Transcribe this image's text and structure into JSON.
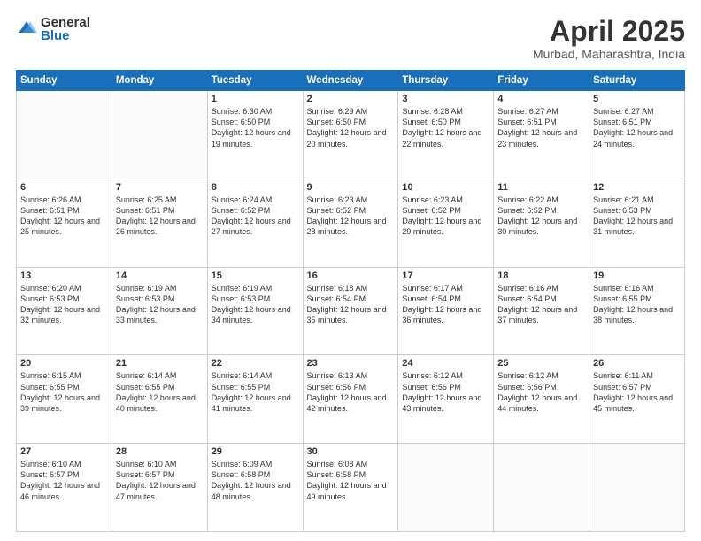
{
  "header": {
    "logo_general": "General",
    "logo_blue": "Blue",
    "title": "April 2025",
    "subtitle": "Murbad, Maharashtra, India"
  },
  "days_of_week": [
    "Sunday",
    "Monday",
    "Tuesday",
    "Wednesday",
    "Thursday",
    "Friday",
    "Saturday"
  ],
  "weeks": [
    [
      {
        "day": "",
        "info": ""
      },
      {
        "day": "",
        "info": ""
      },
      {
        "day": "1",
        "info": "Sunrise: 6:30 AM\nSunset: 6:50 PM\nDaylight: 12 hours and 19 minutes."
      },
      {
        "day": "2",
        "info": "Sunrise: 6:29 AM\nSunset: 6:50 PM\nDaylight: 12 hours and 20 minutes."
      },
      {
        "day": "3",
        "info": "Sunrise: 6:28 AM\nSunset: 6:50 PM\nDaylight: 12 hours and 22 minutes."
      },
      {
        "day": "4",
        "info": "Sunrise: 6:27 AM\nSunset: 6:51 PM\nDaylight: 12 hours and 23 minutes."
      },
      {
        "day": "5",
        "info": "Sunrise: 6:27 AM\nSunset: 6:51 PM\nDaylight: 12 hours and 24 minutes."
      }
    ],
    [
      {
        "day": "6",
        "info": "Sunrise: 6:26 AM\nSunset: 6:51 PM\nDaylight: 12 hours and 25 minutes."
      },
      {
        "day": "7",
        "info": "Sunrise: 6:25 AM\nSunset: 6:51 PM\nDaylight: 12 hours and 26 minutes."
      },
      {
        "day": "8",
        "info": "Sunrise: 6:24 AM\nSunset: 6:52 PM\nDaylight: 12 hours and 27 minutes."
      },
      {
        "day": "9",
        "info": "Sunrise: 6:23 AM\nSunset: 6:52 PM\nDaylight: 12 hours and 28 minutes."
      },
      {
        "day": "10",
        "info": "Sunrise: 6:23 AM\nSunset: 6:52 PM\nDaylight: 12 hours and 29 minutes."
      },
      {
        "day": "11",
        "info": "Sunrise: 6:22 AM\nSunset: 6:52 PM\nDaylight: 12 hours and 30 minutes."
      },
      {
        "day": "12",
        "info": "Sunrise: 6:21 AM\nSunset: 6:53 PM\nDaylight: 12 hours and 31 minutes."
      }
    ],
    [
      {
        "day": "13",
        "info": "Sunrise: 6:20 AM\nSunset: 6:53 PM\nDaylight: 12 hours and 32 minutes."
      },
      {
        "day": "14",
        "info": "Sunrise: 6:19 AM\nSunset: 6:53 PM\nDaylight: 12 hours and 33 minutes."
      },
      {
        "day": "15",
        "info": "Sunrise: 6:19 AM\nSunset: 6:53 PM\nDaylight: 12 hours and 34 minutes."
      },
      {
        "day": "16",
        "info": "Sunrise: 6:18 AM\nSunset: 6:54 PM\nDaylight: 12 hours and 35 minutes."
      },
      {
        "day": "17",
        "info": "Sunrise: 6:17 AM\nSunset: 6:54 PM\nDaylight: 12 hours and 36 minutes."
      },
      {
        "day": "18",
        "info": "Sunrise: 6:16 AM\nSunset: 6:54 PM\nDaylight: 12 hours and 37 minutes."
      },
      {
        "day": "19",
        "info": "Sunrise: 6:16 AM\nSunset: 6:55 PM\nDaylight: 12 hours and 38 minutes."
      }
    ],
    [
      {
        "day": "20",
        "info": "Sunrise: 6:15 AM\nSunset: 6:55 PM\nDaylight: 12 hours and 39 minutes."
      },
      {
        "day": "21",
        "info": "Sunrise: 6:14 AM\nSunset: 6:55 PM\nDaylight: 12 hours and 40 minutes."
      },
      {
        "day": "22",
        "info": "Sunrise: 6:14 AM\nSunset: 6:55 PM\nDaylight: 12 hours and 41 minutes."
      },
      {
        "day": "23",
        "info": "Sunrise: 6:13 AM\nSunset: 6:56 PM\nDaylight: 12 hours and 42 minutes."
      },
      {
        "day": "24",
        "info": "Sunrise: 6:12 AM\nSunset: 6:56 PM\nDaylight: 12 hours and 43 minutes."
      },
      {
        "day": "25",
        "info": "Sunrise: 6:12 AM\nSunset: 6:56 PM\nDaylight: 12 hours and 44 minutes."
      },
      {
        "day": "26",
        "info": "Sunrise: 6:11 AM\nSunset: 6:57 PM\nDaylight: 12 hours and 45 minutes."
      }
    ],
    [
      {
        "day": "27",
        "info": "Sunrise: 6:10 AM\nSunset: 6:57 PM\nDaylight: 12 hours and 46 minutes."
      },
      {
        "day": "28",
        "info": "Sunrise: 6:10 AM\nSunset: 6:57 PM\nDaylight: 12 hours and 47 minutes."
      },
      {
        "day": "29",
        "info": "Sunrise: 6:09 AM\nSunset: 6:58 PM\nDaylight: 12 hours and 48 minutes."
      },
      {
        "day": "30",
        "info": "Sunrise: 6:08 AM\nSunset: 6:58 PM\nDaylight: 12 hours and 49 minutes."
      },
      {
        "day": "",
        "info": ""
      },
      {
        "day": "",
        "info": ""
      },
      {
        "day": "",
        "info": ""
      }
    ]
  ]
}
